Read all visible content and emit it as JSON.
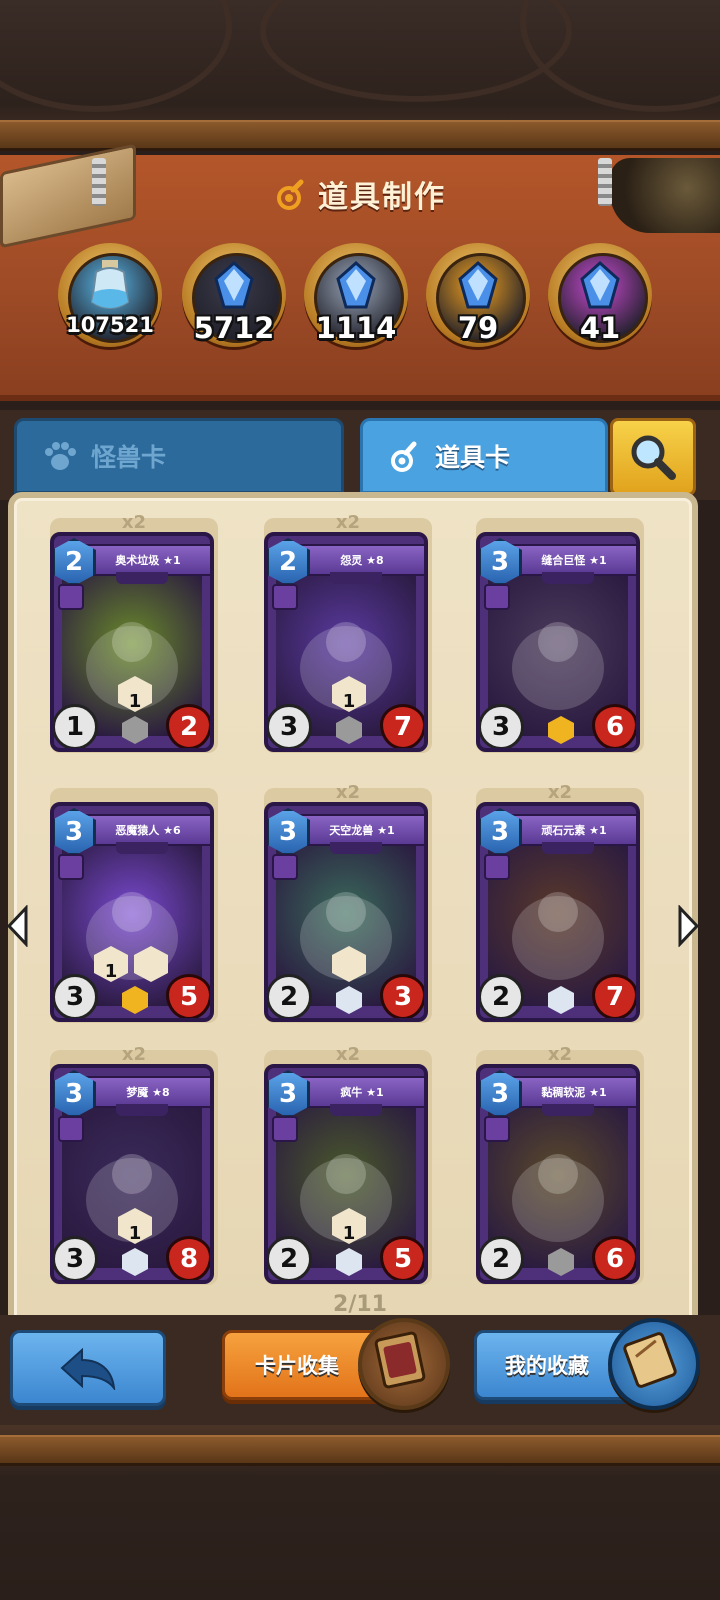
{
  "header": {
    "title": "道具制作"
  },
  "resources": [
    {
      "name": "dust-jar",
      "count": "107521",
      "color": "#5ab8e8"
    },
    {
      "name": "common-shard",
      "count": "5712",
      "color": "#3a3a4a"
    },
    {
      "name": "rare-shard",
      "count": "1114",
      "color": "#9aa6b8"
    },
    {
      "name": "epic-shard",
      "count": "79",
      "color": "#f0a020"
    },
    {
      "name": "legendary-shard",
      "count": "41",
      "color": "#c84ad0"
    }
  ],
  "tabs": {
    "monster": "怪兽卡",
    "item": "道具卡"
  },
  "cards": [
    {
      "qty": "x2",
      "name": "奥术垃圾 ★1",
      "cost": "2",
      "atk": "1",
      "hp": "2",
      "abilities": [
        "1"
      ],
      "rarity": "common",
      "art": "#6a8a2a"
    },
    {
      "qty": "x2",
      "name": "怨灵 ★8",
      "cost": "2",
      "atk": "3",
      "hp": "7",
      "abilities": [
        "1"
      ],
      "rarity": "common",
      "art": "#5a3aa0"
    },
    {
      "qty": "",
      "name": "缝合巨怪 ★1",
      "cost": "3",
      "atk": "3",
      "hp": "6",
      "abilities": [],
      "rarity": "gold",
      "art": "#4a3a5a"
    },
    {
      "qty": "",
      "name": "恶魔猿人 ★6",
      "cost": "3",
      "atk": "3",
      "hp": "5",
      "abilities": [
        "1",
        ""
      ],
      "rarity": "gold",
      "art": "#7a4ad0"
    },
    {
      "qty": "x2",
      "name": "天空龙兽 ★1",
      "cost": "3",
      "atk": "2",
      "hp": "3",
      "abilities": [
        ""
      ],
      "rarity": "silver",
      "art": "#3a6a5a"
    },
    {
      "qty": "x2",
      "name": "顽石元素 ★1",
      "cost": "3",
      "atk": "2",
      "hp": "7",
      "abilities": [],
      "rarity": "silver",
      "art": "#5a3a2a"
    },
    {
      "qty": "x2",
      "name": "梦魇 ★8",
      "cost": "3",
      "atk": "3",
      "hp": "8",
      "abilities": [
        "1"
      ],
      "rarity": "silver",
      "art": "#3a2a5a"
    },
    {
      "qty": "x2",
      "name": "疯牛 ★1",
      "cost": "3",
      "atk": "2",
      "hp": "5",
      "abilities": [
        "1"
      ],
      "rarity": "silver",
      "art": "#4a5a2a"
    },
    {
      "qty": "x2",
      "name": "黏稠软泥 ★1",
      "cost": "3",
      "atk": "2",
      "hp": "6",
      "abilities": [],
      "rarity": "common",
      "art": "#5a4a2a"
    }
  ],
  "pagination": {
    "text": "2/11"
  },
  "buttons": {
    "collect": "卡片收集",
    "favorites": "我的收藏"
  }
}
